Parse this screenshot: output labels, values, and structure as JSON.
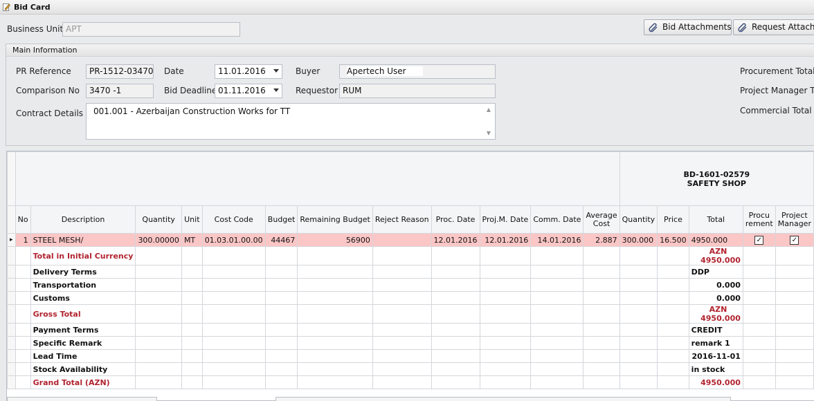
{
  "window": {
    "title": "Bid Card",
    "icon": "edit-pencil-icon"
  },
  "header": {
    "business_unit_label": "Business Unit",
    "business_unit_value": "APT",
    "bid_attachments_label": "Bid Attachments",
    "request_attachments_label": "Request Attachm",
    "attachment_icon": "paperclip-icon"
  },
  "main_info": {
    "group_title": "Main Information",
    "pr_reference_label": "PR Reference",
    "pr_reference_value": "PR-1512-03470",
    "date_label": "Date",
    "date_value": "11.01.2016",
    "buyer_label": "Buyer",
    "buyer_value": "Apertech User",
    "comparison_no_label": "Comparison No",
    "comparison_no_value": "3470 -1",
    "bid_deadline_label": "Bid Deadline",
    "bid_deadline_value": "01.11.2016",
    "requestor_label": "Requestor",
    "requestor_value": "RUM",
    "contract_details_label": "Contract Details",
    "contract_details_value": "001.001 - Azerbaijan Construction Works for TT",
    "procurement_total_label": "Procurement Total",
    "project_manager_total_label": "Project Manager To",
    "commercial_total_label": "Commercial Total"
  },
  "grid": {
    "band_code": "BD-1601-02579",
    "band_vendor": "SAFETY SHOP",
    "columns": {
      "no": "No",
      "description": "Description",
      "quantity": "Quantity",
      "unit": "Unit",
      "cost_code": "Cost Code",
      "budget": "Budget",
      "remaining_budget": "Remaining Budget",
      "reject_reason": "Reject Reason",
      "proc_date": "Proc. Date",
      "projm_date": "Proj.M. Date",
      "comm_date": "Comm. Date",
      "average_cost": "Average Cost",
      "v_quantity": "Quantity",
      "v_price": "Price",
      "v_total": "Total",
      "procurement": "Procu rement",
      "project_manager": "Project Manager"
    },
    "row": {
      "indicator": "▸",
      "no": "1",
      "description": "STEEL MESH/",
      "quantity": "300.00000",
      "unit": "MT",
      "cost_code": "01.03.01.00.00",
      "budget": "44467",
      "remaining_budget": "56900",
      "reject_reason": "",
      "proc_date": "12.01.2016",
      "projm_date": "12.01.2016",
      "comm_date": "14.01.2016",
      "average_cost": "2.887",
      "v_quantity": "300.000",
      "v_price": "16.500",
      "v_total": "4950.000",
      "procurement_checked": "✓",
      "project_manager_checked": "✓"
    },
    "summary": [
      {
        "label": "Total in Initial Currency",
        "currency": "AZN",
        "value": "4950.000",
        "align": "right",
        "red": true
      },
      {
        "label": "Delivery Terms",
        "currency": "",
        "value": "DDP",
        "align": "left",
        "red": false
      },
      {
        "label": "Transportation",
        "currency": "",
        "value": "0.000",
        "align": "right",
        "red": false
      },
      {
        "label": "Customs",
        "currency": "",
        "value": "0.000",
        "align": "right",
        "red": false
      },
      {
        "label": "Gross Total",
        "currency": "AZN",
        "value": "4950.000",
        "align": "right",
        "red": true
      },
      {
        "label": "Payment Terms",
        "currency": "",
        "value": "CREDIT",
        "align": "left",
        "red": false
      },
      {
        "label": "Specific Remark",
        "currency": "",
        "value": "remark 1",
        "align": "left",
        "red": false
      },
      {
        "label": "Lead Time",
        "currency": "",
        "value": "2016-11-01",
        "align": "right",
        "red": false
      },
      {
        "label": "Stock Availability",
        "currency": "",
        "value": "in stock",
        "align": "left",
        "red": false
      },
      {
        "label": "Grand Total (AZN)",
        "currency": "",
        "value": "4950.000",
        "align": "right",
        "red": true
      }
    ]
  },
  "colors": {
    "accent_red": "#b1232f",
    "selected_row": "#fbc6c6",
    "background": "#e9eaec"
  }
}
